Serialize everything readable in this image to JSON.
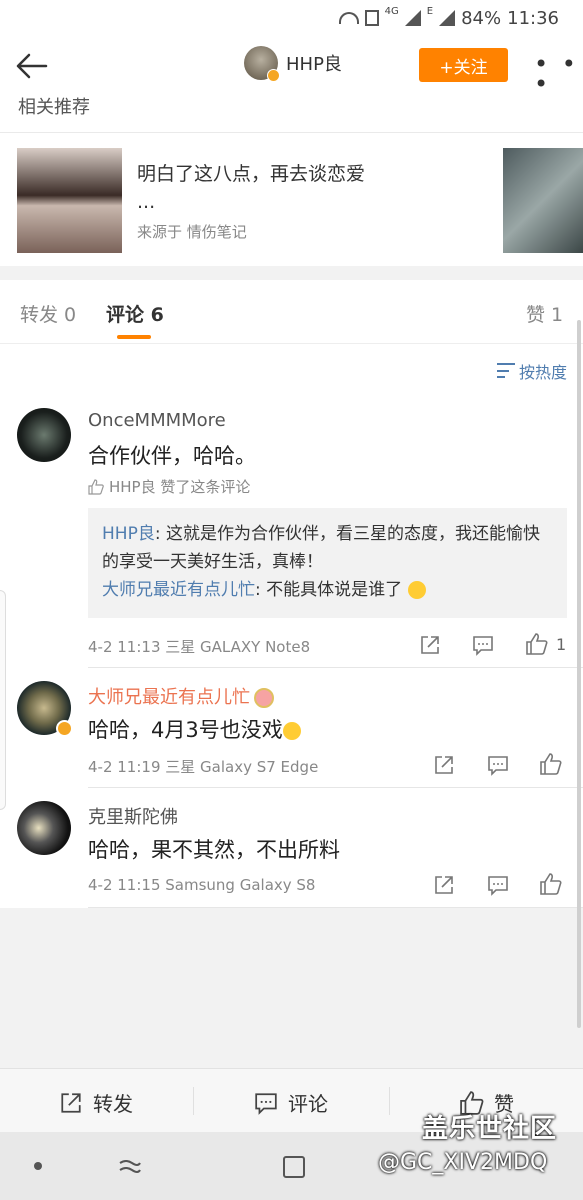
{
  "status_bar": {
    "net_label": "4G",
    "e_label": "E",
    "battery": "84%",
    "time": "11:36"
  },
  "nav": {
    "username": "HHP良",
    "follow_label": "+关注",
    "more_label": "• • •"
  },
  "related": {
    "header": "相关推荐",
    "item_title": "明白了这八点，再去谈恋爱",
    "item_ellipsis": "...",
    "item_source": "来源于 情伤笔记"
  },
  "tabs": {
    "repost": "转发 0",
    "comment": "评论 6",
    "like": "赞 1"
  },
  "sort_label": "按热度",
  "comments": [
    {
      "name": "OnceMMMMore",
      "text": "合作伙伴，哈哈。",
      "liked_by": "HHP良 赞了这条评论",
      "reply": {
        "name1": "HHP良",
        "text1": ": 这就是作为合作伙伴，看三星的态度，我还能愉快的享受一天美好生活，真棒！",
        "name2": "大师兄最近有点儿忙",
        "text2": ": 不能具体说是谁了"
      },
      "meta": "4-2 11:13 三星 GALAXY Note8",
      "like_count": "1"
    },
    {
      "name": "大师兄最近有点儿忙",
      "text": "哈哈，4月3号也没戏",
      "meta": "4-2 11:19 三星 Galaxy S7 Edge"
    },
    {
      "name": "克里斯陀佛",
      "text": "哈哈，果不其然，不出所料",
      "meta": "4-2 11:15 Samsung Galaxy S8"
    }
  ],
  "bottom_bar": {
    "repost": "转发",
    "comment": "评论",
    "like": "赞"
  },
  "watermark": {
    "logo": "盖乐世社区",
    "id": "@GC_XIV2MDQ"
  },
  "colors": {
    "accent": "#ff8200",
    "link": "#507daf",
    "name_highlight": "#eb7350"
  }
}
